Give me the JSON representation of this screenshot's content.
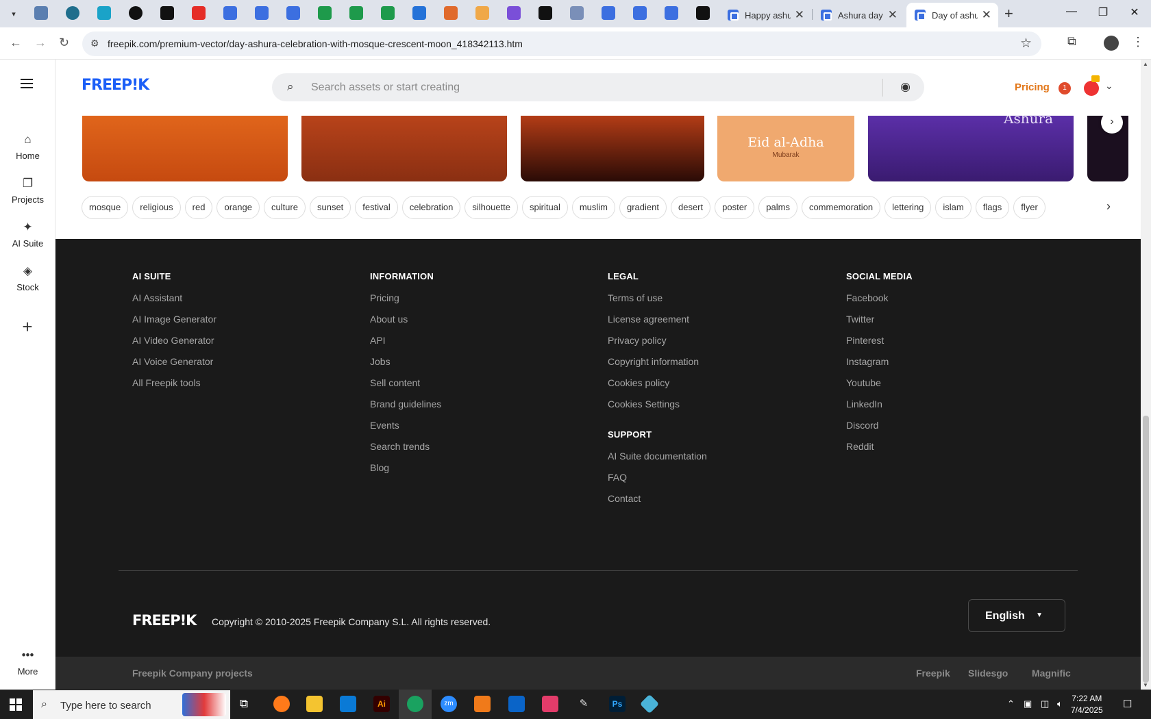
{
  "browser": {
    "tabs": [
      {
        "title": "Happy ashu",
        "active": false
      },
      {
        "title": "Ashura day",
        "active": false
      },
      {
        "title": "Day of ashu",
        "active": true
      }
    ],
    "url": "freepik.com/premium-vector/day-ashura-celebration-with-mosque-crescent-moon_418342113.htm",
    "new_tab": "+",
    "close_glyph": "✕"
  },
  "sidebar": {
    "items": [
      {
        "label": "Home",
        "icon": "home-icon"
      },
      {
        "label": "Projects",
        "icon": "projects-icon"
      },
      {
        "label": "AI Suite",
        "icon": "sparkle-icon"
      },
      {
        "label": "Stock",
        "icon": "stock-icon"
      }
    ],
    "more_label": "More"
  },
  "header": {
    "logo": "FREEP!K",
    "search_placeholder": "Search assets or start creating",
    "pricing": "Pricing",
    "notification_count": "1"
  },
  "tags": [
    "mosque",
    "religious",
    "red",
    "orange",
    "culture",
    "sunset",
    "festival",
    "celebration",
    "silhouette",
    "spiritual",
    "muslim",
    "gradient",
    "desert",
    "poster",
    "palms",
    "commemoration",
    "lettering",
    "islam",
    "flags",
    "flyer"
  ],
  "thumbnails": [
    {
      "text": ""
    },
    {
      "text": ""
    },
    {
      "text": ""
    },
    {
      "text": "Eid al-Adha",
      "sub": "Mubarak"
    },
    {
      "text": "Ashura"
    }
  ],
  "footer": {
    "columns": [
      {
        "heading": "AI SUITE",
        "links": [
          "AI Assistant",
          "AI Image Generator",
          "AI Video Generator",
          "AI Voice Generator",
          "All Freepik tools"
        ]
      },
      {
        "heading": "INFORMATION",
        "links": [
          "Pricing",
          "About us",
          "API",
          "Jobs",
          "Sell content",
          "Brand guidelines",
          "Events",
          "Search trends",
          "Blog"
        ]
      },
      {
        "heading": "LEGAL",
        "links": [
          "Terms of use",
          "License agreement",
          "Privacy policy",
          "Copyright information",
          "Cookies policy",
          "Cookies Settings"
        ]
      },
      {
        "heading": "SOCIAL MEDIA",
        "links": [
          "Facebook",
          "Twitter",
          "Pinterest",
          "Instagram",
          "Youtube",
          "LinkedIn",
          "Discord",
          "Reddit"
        ]
      }
    ],
    "support": {
      "heading": "SUPPORT",
      "links": [
        "AI Suite documentation",
        "FAQ",
        "Contact"
      ]
    },
    "logo": "FREEP!K",
    "copyright": "Copyright © 2010-2025 Freepik Company S.L. All rights reserved.",
    "language": "English",
    "company_projects": "Freepik Company projects",
    "projects": [
      "Freepik",
      "Slidesgo",
      "Magnific"
    ]
  },
  "taskbar": {
    "search_placeholder": "Type here to search",
    "time": "7:22 AM",
    "date": "7/4/2025",
    "ps_label": "Ps",
    "ai_label": "Ai",
    "zoom_label": "zm"
  }
}
